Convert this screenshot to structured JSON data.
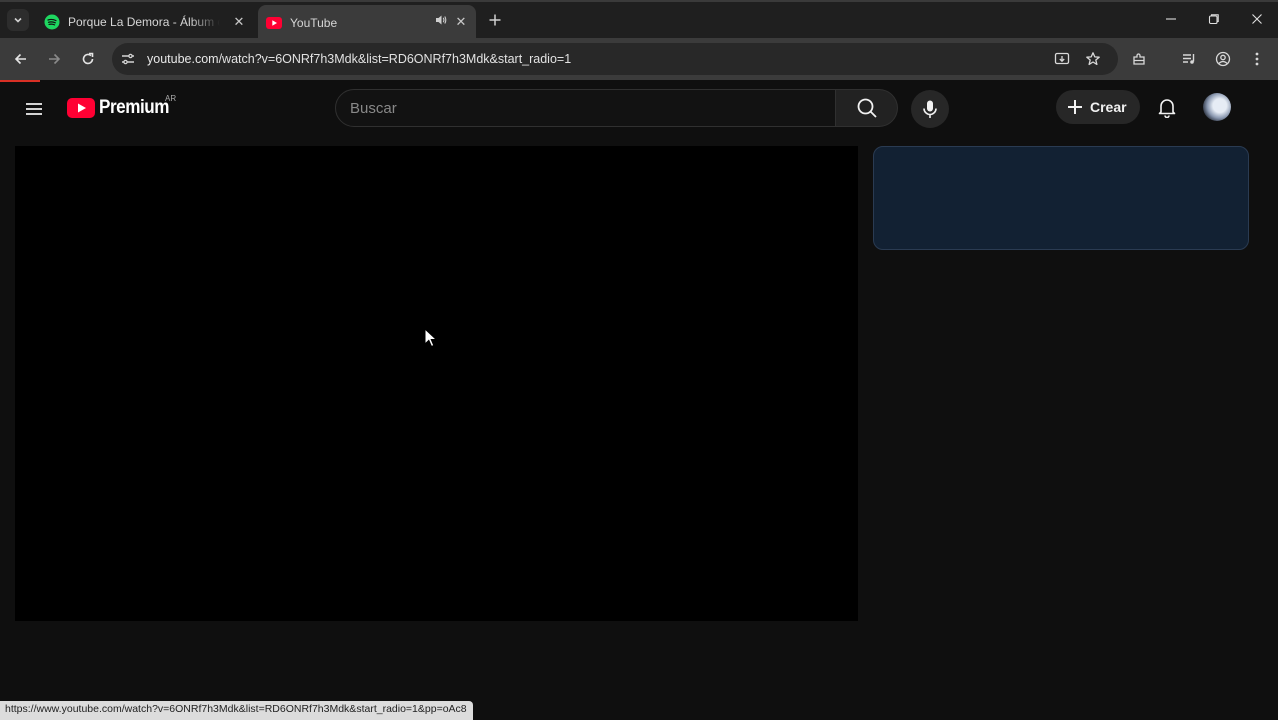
{
  "browser": {
    "tabs": [
      {
        "title": "Porque La Demora - Álbum de",
        "favicon": "spotify-icon",
        "active": false
      },
      {
        "title": "YouTube",
        "favicon": "youtube-icon",
        "active": true,
        "audio": true
      }
    ],
    "address_bar": {
      "url_host": "youtube.com",
      "url_rest": "/watch?v=6ONRf7h3Mdk&list=RD6ONRf7h3Mdk&start_radio=1"
    },
    "status_url": "https://www.youtube.com/watch?v=6ONRf7h3Mdk&list=RD6ONRf7h3Mdk&start_radio=1&pp=oAc8"
  },
  "youtube": {
    "logo_text": "Premium",
    "country_code": "AR",
    "search": {
      "placeholder": "Buscar",
      "value": ""
    },
    "create_label": "Crear"
  },
  "colors": {
    "brand_red": "#ff0033",
    "spotify_green": "#1ed760",
    "page_bg": "#0f0f0f",
    "side_card_bg": "#122133"
  }
}
